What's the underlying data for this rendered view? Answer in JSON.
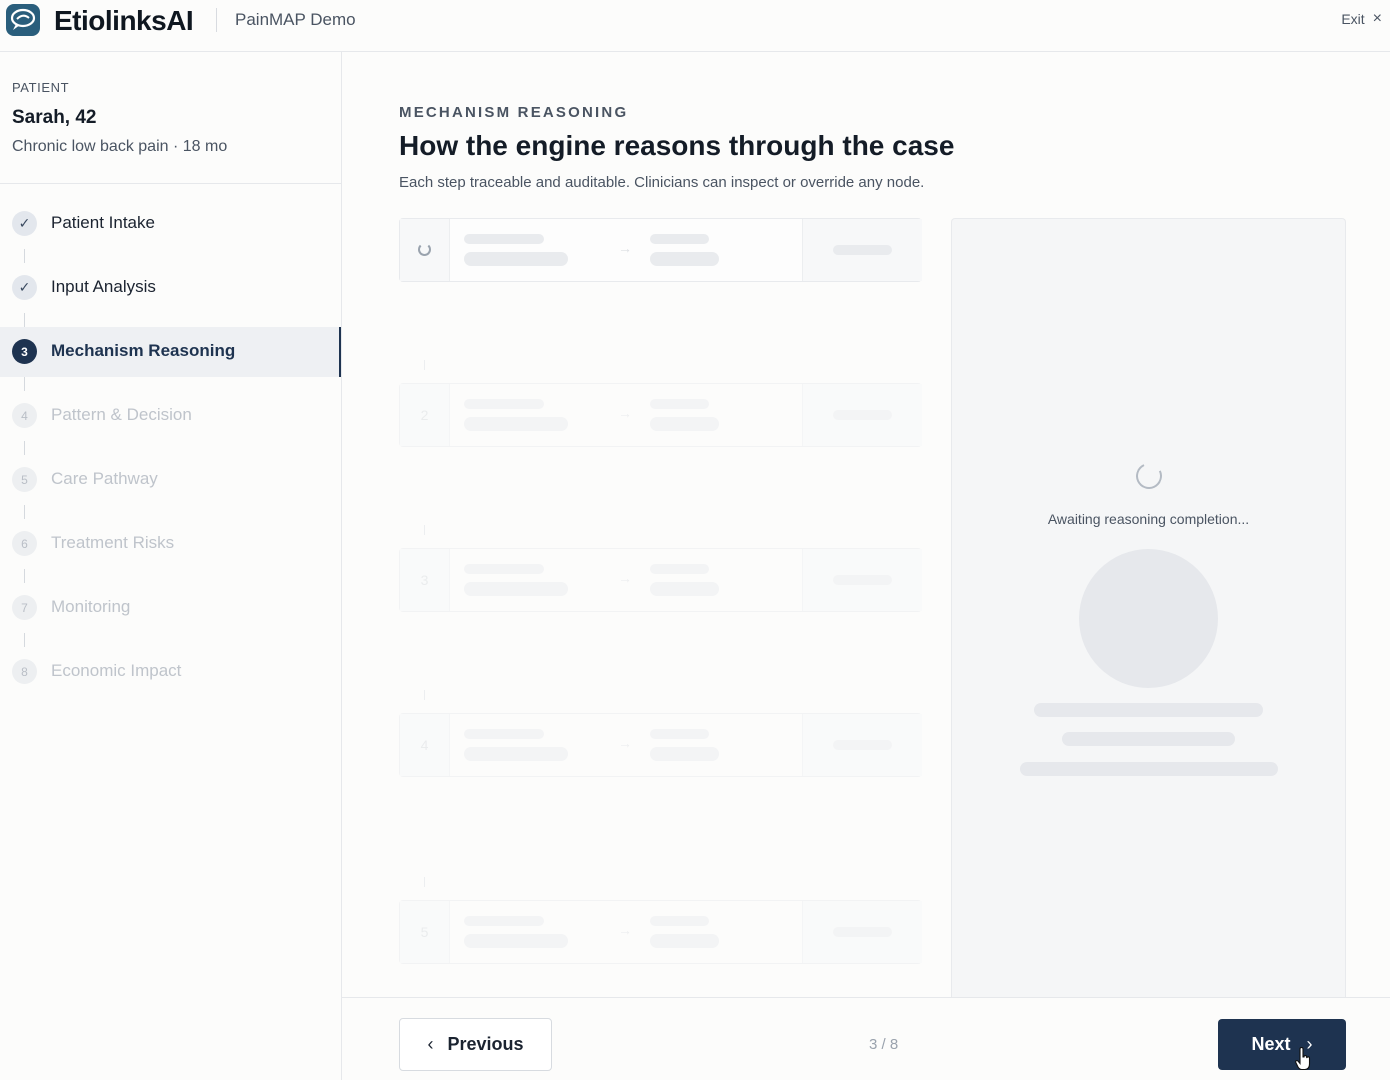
{
  "header": {
    "brand": "EtiolinksAI",
    "app_name": "PainMAP Demo",
    "exit_label": "Exit",
    "exit_icon": "×"
  },
  "patient": {
    "label": "PATIENT",
    "name": "Sarah, 42",
    "condition": "Chronic low back pain · 18 mo"
  },
  "steps": [
    {
      "badge": "✓",
      "label": "Patient Intake",
      "state": "done"
    },
    {
      "badge": "✓",
      "label": "Input Analysis",
      "state": "done"
    },
    {
      "badge": "3",
      "label": "Mechanism Reasoning",
      "state": "active"
    },
    {
      "badge": "4",
      "label": "Pattern & Decision",
      "state": "pending"
    },
    {
      "badge": "5",
      "label": "Care Pathway",
      "state": "pending"
    },
    {
      "badge": "6",
      "label": "Treatment Risks",
      "state": "pending"
    },
    {
      "badge": "7",
      "label": "Monitoring",
      "state": "pending"
    },
    {
      "badge": "8",
      "label": "Economic Impact",
      "state": "pending"
    }
  ],
  "main": {
    "eyebrow": "MECHANISM REASONING",
    "title": "How the engine reasons through the case",
    "subtitle": "Each step traceable and auditable. Clinicians can inspect or override any node."
  },
  "nodes": [
    {
      "num": "",
      "loading": true
    },
    {
      "num": "2",
      "loading": false
    },
    {
      "num": "3",
      "loading": false
    },
    {
      "num": "4",
      "loading": false
    },
    {
      "num": "5",
      "loading": false
    }
  ],
  "panel": {
    "status": "Awaiting reasoning completion..."
  },
  "footer": {
    "previous_label": "Previous",
    "next_label": "Next",
    "page_count": "3 / 8",
    "prev_icon": "‹",
    "next_icon": "›"
  },
  "colors": {
    "accent": "#1e3350",
    "brand_logo": "#2a5e7c"
  }
}
